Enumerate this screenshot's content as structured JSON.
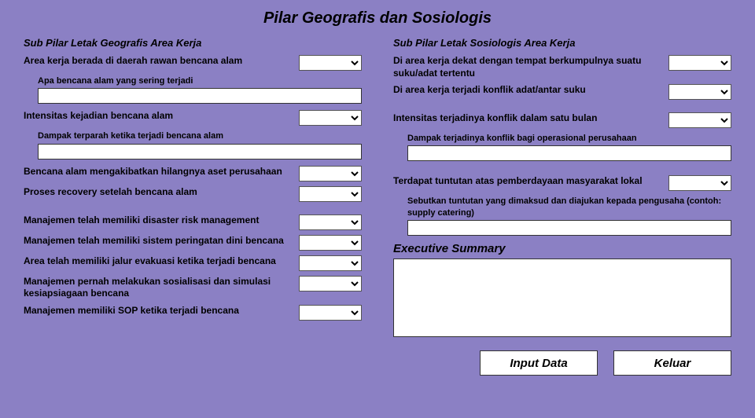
{
  "title": "Pilar Geografis dan Sosiologis",
  "left": {
    "header": "Sub Pilar Letak Geografis Area Kerja",
    "q1": "Area kerja berada di daerah rawan bencana alam",
    "q1_sub": "Apa bencana alam yang sering terjadi",
    "q2": "Intensitas kejadian bencana alam",
    "q2_sub": "Dampak terparah ketika terjadi bencana alam",
    "q3": "Bencana alam mengakibatkan hilangnya aset perusahaan",
    "q4": "Proses recovery setelah bencana alam",
    "q5": "Manajemen telah memiliki disaster risk management",
    "q6": "Manajemen telah memiliki sistem peringatan dini bencana",
    "q7": "Area telah memiliki jalur evakuasi ketika terjadi bencana",
    "q8": "Manajemen pernah melakukan sosialisasi dan simulasi kesiapsiagaan bencana",
    "q9": "Manajemen memiliki SOP ketika terjadi bencana"
  },
  "right": {
    "header": "Sub Pilar Letak Sosiologis Area Kerja",
    "q1": "Di area kerja dekat dengan tempat berkumpulnya suatu suku/adat tertentu",
    "q2": "Di area kerja terjadi konflik adat/antar suku",
    "q3": "Intensitas terjadinya konflik dalam satu bulan",
    "q3_sub": "Dampak terjadinya konflik bagi operasional perusahaan",
    "q4": "Terdapat tuntutan atas pemberdayaan masyarakat lokal",
    "q4_sub": "Sebutkan tuntutan yang dimaksud dan diajukan kepada pengusaha (contoh: supply catering)"
  },
  "exec_header": "Executive Summary",
  "buttons": {
    "input": "Input Data",
    "keluar": "Keluar"
  },
  "values": {
    "left_q1": "",
    "left_q1_text": "",
    "left_q2": "",
    "left_q2_text": "",
    "left_q3": "",
    "left_q4": "",
    "left_q5": "",
    "left_q6": "",
    "left_q7": "",
    "left_q8": "",
    "left_q9": "",
    "right_q1": "",
    "right_q2": "",
    "right_q3": "",
    "right_q3_text": "",
    "right_q4": "",
    "right_q4_text": "",
    "exec_summary": ""
  }
}
